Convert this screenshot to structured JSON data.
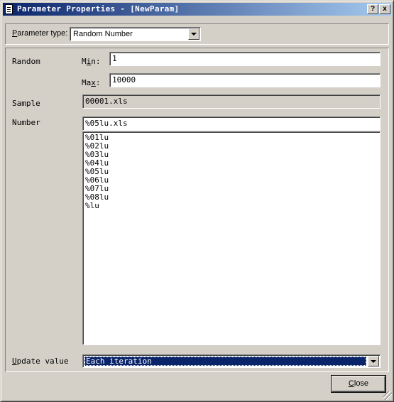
{
  "window": {
    "title": "Parameter Properties - [NewParam]",
    "help_label": "?",
    "close_label": "x"
  },
  "parameter_type": {
    "label_prefix": "P",
    "label_rest": "arameter type:",
    "value": "Random Number"
  },
  "random": {
    "label": "Random",
    "min_label_prefix": "M",
    "min_label_underlined": "i",
    "min_label_rest": "n:",
    "min_value": "1",
    "max_label_prefix": "Ma",
    "max_label_underlined": "x",
    "max_label_rest": ":",
    "max_value": "10000"
  },
  "sample": {
    "label": "Sample",
    "value": "00001.xls"
  },
  "number": {
    "label": "Number",
    "value": "%05lu.xls",
    "formats": [
      "%01lu",
      "%02lu",
      "%03lu",
      "%04lu",
      "%05lu",
      "%06lu",
      "%07lu",
      "%08lu",
      "%lu"
    ]
  },
  "update_value": {
    "label_underlined": "U",
    "label_rest": "pdate value",
    "value": "Each iteration"
  },
  "footer": {
    "close_underlined": "C",
    "close_rest": "lose"
  }
}
